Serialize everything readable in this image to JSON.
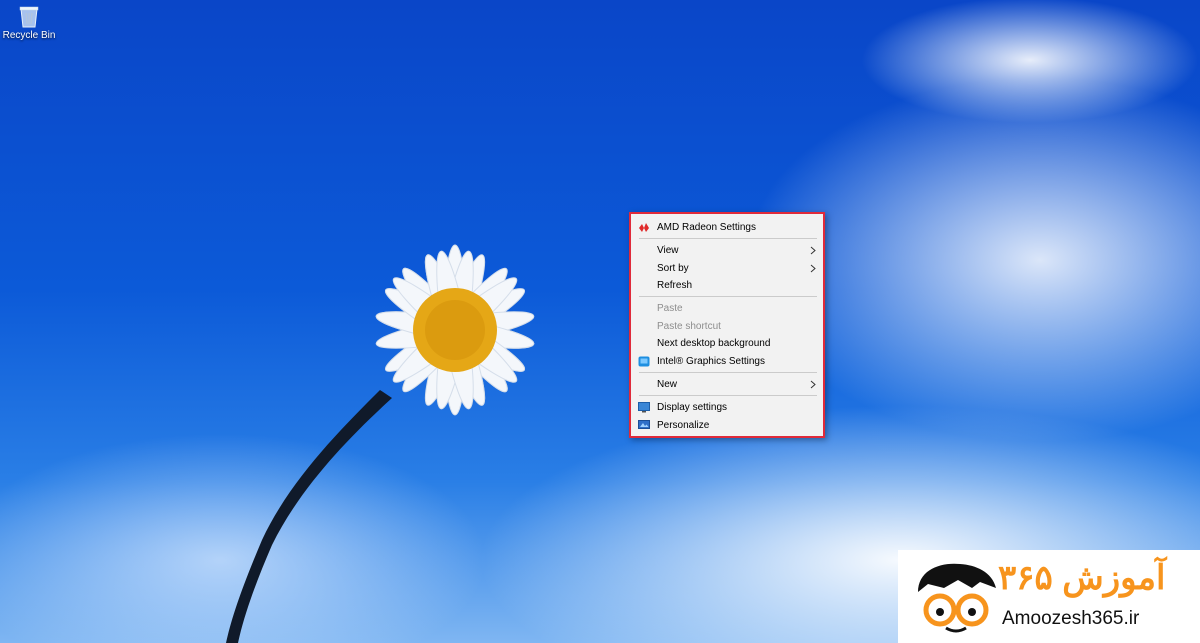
{
  "desktop": {
    "icons": [
      {
        "label": "Recycle Bin",
        "icon": "recycle-bin-icon"
      }
    ]
  },
  "context_menu": {
    "items": [
      {
        "label": "AMD Radeon Settings",
        "icon": "amd-radeon-icon",
        "enabled": true
      },
      {
        "label": "View",
        "submenu": true,
        "enabled": true
      },
      {
        "label": "Sort by",
        "submenu": true,
        "enabled": true
      },
      {
        "label": "Refresh",
        "enabled": true
      },
      {
        "label": "Paste",
        "enabled": false
      },
      {
        "label": "Paste shortcut",
        "enabled": false
      },
      {
        "label": "Next desktop background",
        "enabled": true
      },
      {
        "label": "Intel® Graphics Settings",
        "icon": "intel-graphics-icon",
        "enabled": true
      },
      {
        "label": "New",
        "submenu": true,
        "enabled": true
      },
      {
        "label": "Display settings",
        "icon": "display-settings-icon",
        "enabled": true
      },
      {
        "label": "Personalize",
        "icon": "personalize-icon",
        "enabled": true
      }
    ],
    "highlight_color": "#e02a3a"
  },
  "watermark": {
    "persian_text": "آموزش ۳۶۵",
    "site": "Amoozesh365.ir",
    "accent": "#f7941d"
  }
}
